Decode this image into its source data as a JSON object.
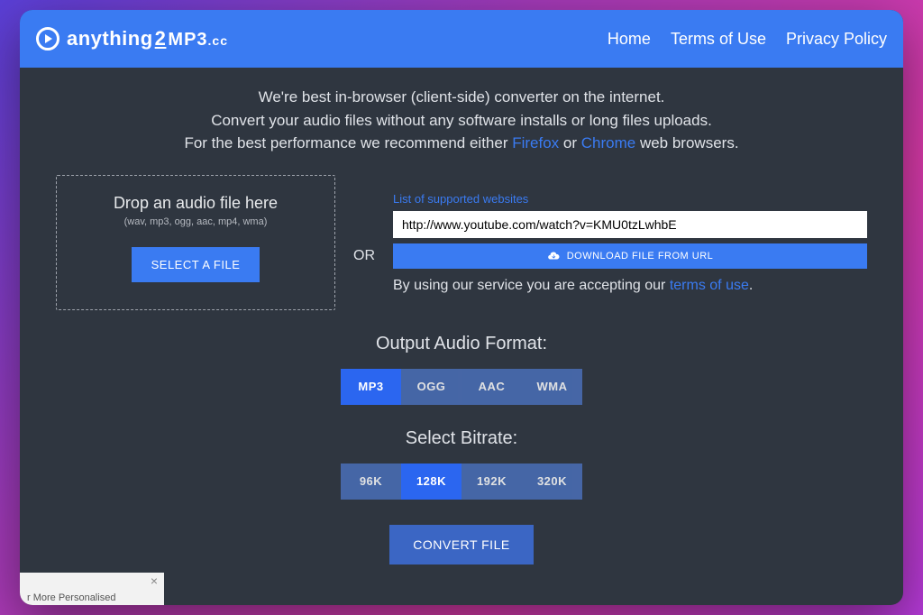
{
  "header": {
    "logo_brand_1": "anything",
    "logo_brand_2": "2",
    "logo_brand_3": "MP3",
    "logo_brand_4": ".cc",
    "nav": {
      "home": "Home",
      "terms": "Terms of Use",
      "privacy": "Privacy Policy"
    }
  },
  "intro": {
    "line1": "We're best in-browser (client-side) converter on the internet.",
    "line2": "Convert your audio files without any software installs or long files uploads.",
    "line3_a": "For the best performance we recommend either ",
    "firefox": "Firefox",
    "line3_or": " or ",
    "chrome": "Chrome",
    "line3_b": " web browsers."
  },
  "dropzone": {
    "title": "Drop an audio file here",
    "sub": "(wav, mp3, ogg, aac, mp4, wma)",
    "button": "SELECT A FILE"
  },
  "or_label": "OR",
  "url": {
    "supported_link": "List of supported websites",
    "value": "http://www.youtube.com/watch?v=KMU0tzLwhbE",
    "download_button": "DOWNLOAD FILE FROM URL",
    "terms_a": "By using our service you are accepting our ",
    "terms_link": "terms of use",
    "terms_b": "."
  },
  "format": {
    "title": "Output Audio Format:",
    "options": [
      "MP3",
      "OGG",
      "AAC",
      "WMA"
    ],
    "active": "MP3"
  },
  "bitrate": {
    "title": "Select Bitrate:",
    "options": [
      "96K",
      "128K",
      "192K",
      "320K"
    ],
    "active": "128K"
  },
  "convert_button": "CONVERT FILE",
  "ad": {
    "text": "r More Personalised"
  }
}
